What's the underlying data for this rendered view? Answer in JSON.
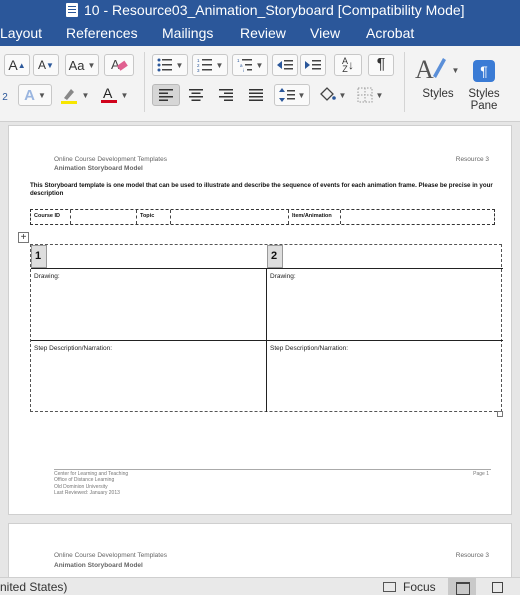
{
  "window": {
    "title": "10 - Resource03_Animation_Storyboard [Compatibility Mode]"
  },
  "ribbon_tabs": [
    "Layout",
    "References",
    "Mailings",
    "Review",
    "View",
    "Acrobat"
  ],
  "ribbon": {
    "grow_font": "A",
    "shrink_font": "A",
    "change_case": "Aa",
    "superscript_fragment": "2",
    "effects_icon": "text-effects-icon",
    "highlight_color": "#f7e600",
    "font_color": "#d0021b",
    "sort_icon": "sort-az-icon",
    "pilcrow": "¶",
    "styles_label": "Styles",
    "styles_pane_label": "Styles Pane"
  },
  "document": {
    "page1": {
      "header_left": "Online Course Development Templates",
      "header_right": "Resource 3",
      "header_subtitle": "Animation Storyboard Model",
      "intro": "This Storyboard template is one model that can be used to illustrate and describe the sequence of events for each animation frame. Please be precise in your description",
      "meta_fields": [
        "Course ID",
        "",
        "Topic",
        "",
        "Item/Animation",
        ""
      ],
      "frames": [
        {
          "number": "1",
          "drawing_label": "Drawing:",
          "step_label": "Step Description/Narration:"
        },
        {
          "number": "2",
          "drawing_label": "Drawing:",
          "step_label": "Step Description/Narration:"
        }
      ],
      "footer_lines": [
        "Center for Learning and Teaching",
        "Office of Distance Learning",
        "Old Dominion University",
        "Last Reviewed: January 2013"
      ],
      "footer_page": "Page 1"
    },
    "page2": {
      "header_left": "Online Course Development Templates",
      "header_right": "Resource 3",
      "header_subtitle": "Animation Storyboard Model"
    }
  },
  "statusbar": {
    "language": "nited States)",
    "focus_label": "Focus"
  }
}
